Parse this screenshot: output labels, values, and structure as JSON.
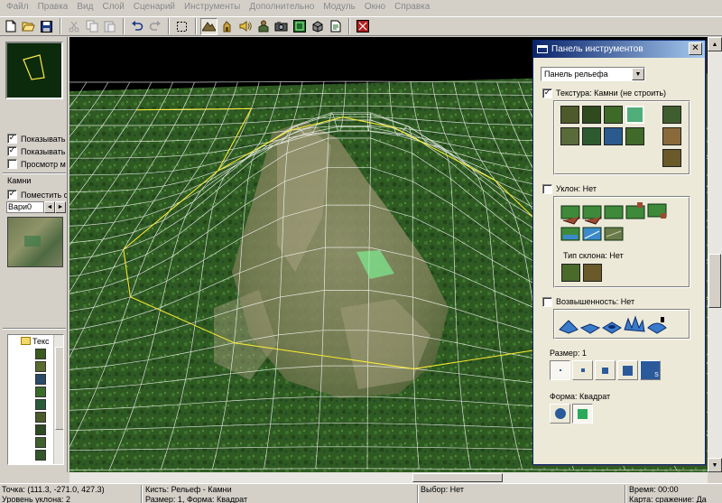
{
  "menu": {
    "items": [
      "Файл",
      "Правка",
      "Вид",
      "Слой",
      "Сценарий",
      "Инструменты",
      "Дополнительно",
      "Модуль",
      "Окно",
      "Справка"
    ]
  },
  "toolbar": {
    "buttons": [
      "new-file-icon",
      "open-folder-icon",
      "save-icon",
      "cut-icon",
      "copy-icon",
      "paste-icon",
      "undo-icon",
      "redo-icon",
      "select-region-icon",
      "terrain-icon",
      "doodad-icon",
      "sound-icon",
      "unit-icon",
      "camera-icon",
      "region-icon",
      "object-icon",
      "script-icon",
      "test-map-icon"
    ]
  },
  "left_panel": {
    "checks": [
      {
        "label": "Показывать",
        "checked": true
      },
      {
        "label": "Показывать",
        "checked": true
      },
      {
        "label": "Просмотр м",
        "checked": false
      }
    ],
    "section_label": "Камни",
    "place_label": "Поместить с",
    "place_checked": true,
    "variant_value": "Вари0",
    "tree_root_label": "Текс"
  },
  "tool_panel": {
    "title": "Панель инструментов",
    "close_glyph": "✕",
    "selector_value": "Панель рельефа",
    "texture_check": {
      "label": "Текстура: Камни (не строить)",
      "checked": true
    },
    "slope_check": {
      "label": "Уклон: Нет",
      "checked": false
    },
    "slope_type_label": "Тип склона: Нет",
    "height_check": {
      "label": "Возвышенность: Нет",
      "checked": false
    },
    "size_label": "Размер: 1",
    "shape_label": "Форма: Квадрат",
    "texture_colors": [
      "#4f5a2a",
      "#2f4a1e",
      "#3e6a28",
      "#4fae7a",
      "#5a6b3a",
      "#2e5a30",
      "#2a5a8e",
      "#3f6a2a",
      "#264a22",
      "#2f5a2c"
    ],
    "side_texture_colors": [
      "#3e5e30",
      "#8a6a3a",
      "#6a5a2a"
    ],
    "slope_type_colors": [
      "#4a6a2a",
      "#6a5a2a"
    ],
    "size_glyphs": [
      "",
      "",
      "",
      "",
      "S"
    ],
    "selected_size": 1,
    "selected_shape": 2
  },
  "colors": {
    "grid_white": "#ffffff",
    "grid_yellow": "#ffee33",
    "ground": "#2f5a22",
    "hill_rock": "#8c8a66",
    "selection": "#7dff9a",
    "titlebar_start": "#0a246a"
  },
  "status": {
    "point": "Точка: (111.3, -271.0, 427.3)",
    "slope_level": "Уровень уклона: 2",
    "brush": "Кисть: Рельеф - Камни",
    "size_shape": "Размер: 1, Форма: Квадрат",
    "selection": "Выбор: Нет",
    "time": "Время: 00:00",
    "map": "Карта: сражение: Да"
  }
}
